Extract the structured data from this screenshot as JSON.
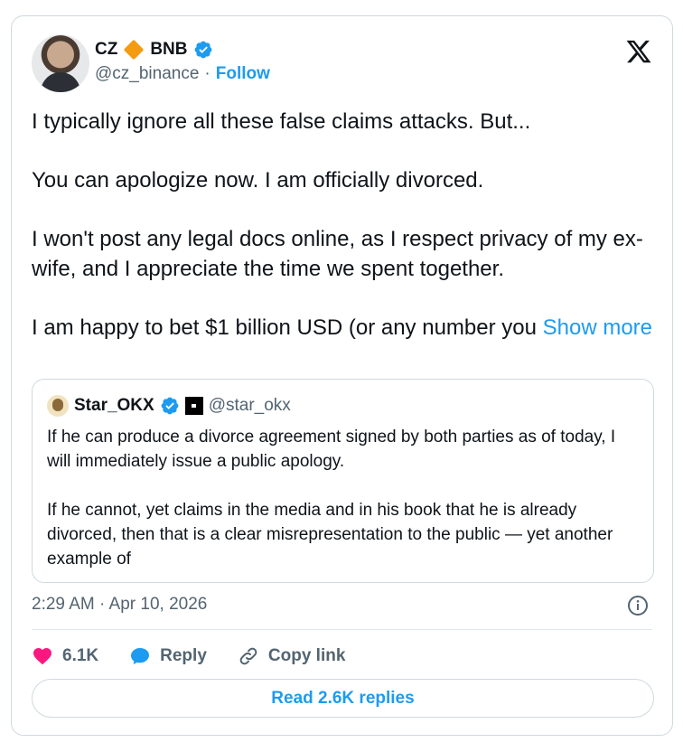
{
  "author": {
    "name": "CZ",
    "name_suffix": "BNB",
    "handle": "@cz_binance",
    "separator": "·",
    "follow_label": "Follow"
  },
  "tweet": {
    "paragraphs": [
      "I typically ignore all these false claims attacks. But...",
      "You can apologize now. I am officially divorced.",
      "I won't post any legal docs online, as I respect privacy of my ex-wife, and I appreciate the time we spent together.",
      "I am happy to bet $1 billion USD (or any number you"
    ],
    "show_more_label": "Show more"
  },
  "quote": {
    "name": "Star_OKX",
    "handle": "@star_okx",
    "paragraphs": [
      "If he can produce a divorce agreement signed by both parties as of today, I will immediately issue a public apology.",
      "If he cannot, yet claims in the media and in his book that he is already divorced, then that is a clear misrepresentation to the public — yet another example of"
    ]
  },
  "timestamp": "2:29 AM · Apr 10, 2026",
  "actions": {
    "likes": "6.1K",
    "reply_label": "Reply",
    "copy_link_label": "Copy link"
  },
  "read_replies_label": "Read 2.6K replies",
  "colors": {
    "accent": "#1d9bf0",
    "like": "#f91880",
    "muted": "#536471",
    "diamond": "#f39c12"
  },
  "icons": [
    "verified-badge-icon",
    "diamond-icon",
    "x-logo-icon",
    "okx-logo-icon",
    "info-icon",
    "heart-icon",
    "reply-bubble-icon",
    "link-icon"
  ]
}
